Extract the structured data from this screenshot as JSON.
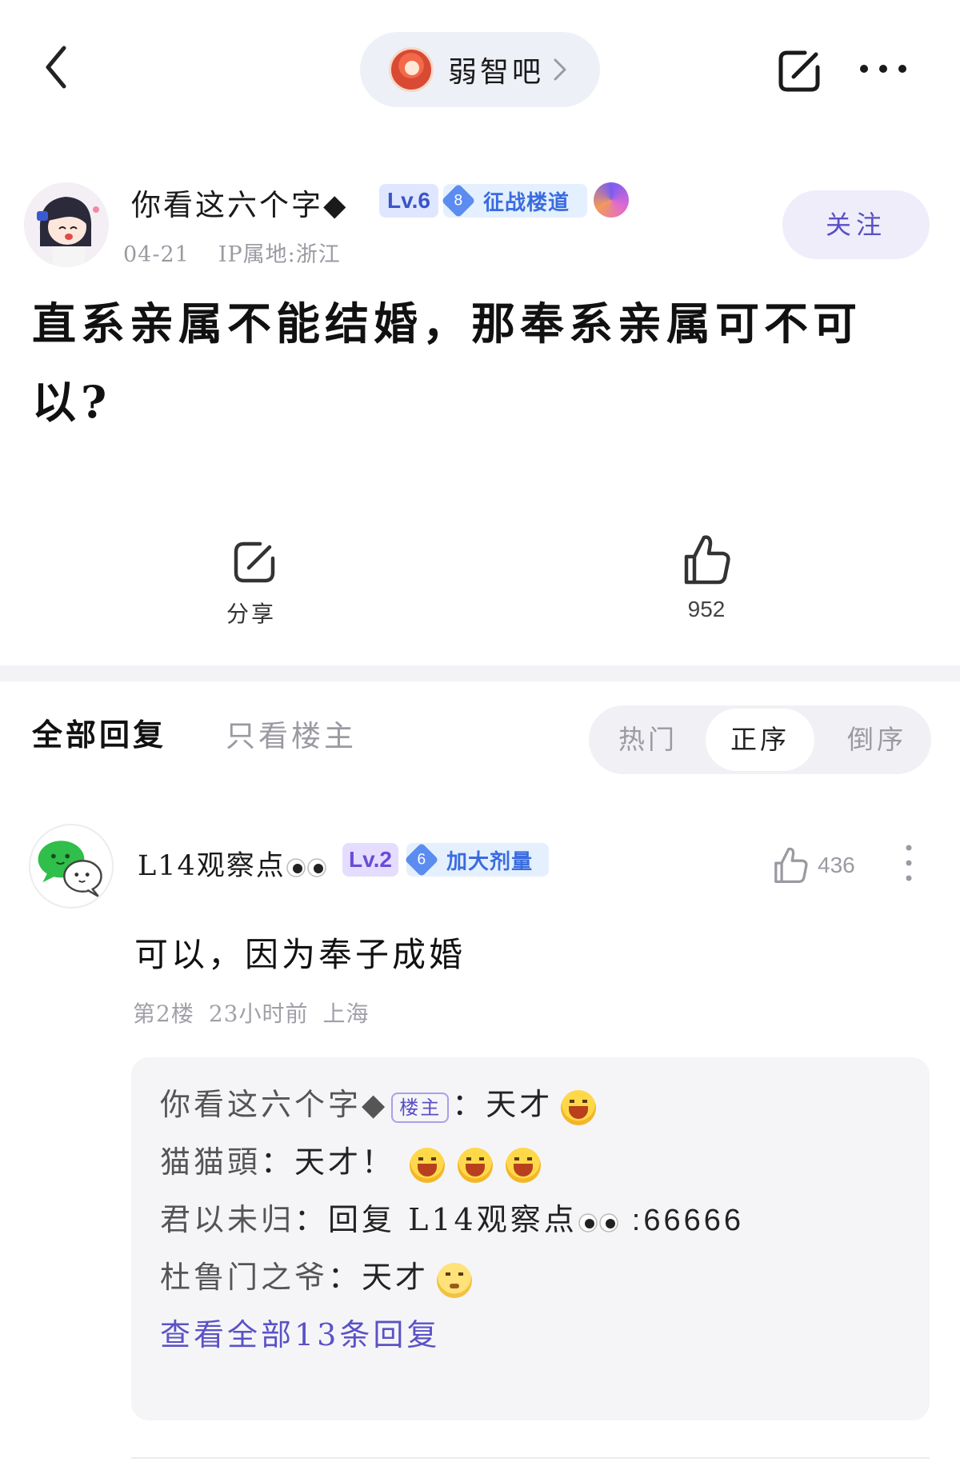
{
  "header": {
    "forum_name": "弱智吧"
  },
  "post": {
    "author_name": "你看这六个字◆",
    "author_level": "Lv.6",
    "author_rank_num": "8",
    "author_rank_title": "征战楼道",
    "date": "04-21",
    "ip_location": "IP属地:浙江",
    "follow_label": "关注",
    "title": "直系亲属不能结婚，那奉系亲属可不可以?",
    "share_label": "分享",
    "like_count": "952"
  },
  "tabs": {
    "all_replies": "全部回复",
    "op_only": "只看楼主",
    "sort_hot": "热门",
    "sort_asc": "正序",
    "sort_desc": "倒序"
  },
  "reply": {
    "author_name": "L14观察点",
    "author_level": "Lv.2",
    "rank_num": "6",
    "rank_title": "加大剂量",
    "like_count": "436",
    "text": "可以，因为奉子成婚",
    "floor": "第2楼",
    "time": "23小时前",
    "location": "上海",
    "sub_replies": [
      {
        "name": "你看这六个字◆",
        "tag": "楼主",
        "text": "天才"
      },
      {
        "name": "猫猫頭",
        "text": "天才！"
      },
      {
        "name": "君以未归",
        "text": "回复 L14观察点",
        "suffix": ":66666"
      },
      {
        "name": "杜鲁门之爷",
        "text": "天才"
      }
    ],
    "view_all": "查看全部13条回复"
  },
  "colors": {
    "accent": "#5b52c6",
    "follow_bg": "#eeedf9",
    "badge_blue": "#3a6ce0"
  }
}
